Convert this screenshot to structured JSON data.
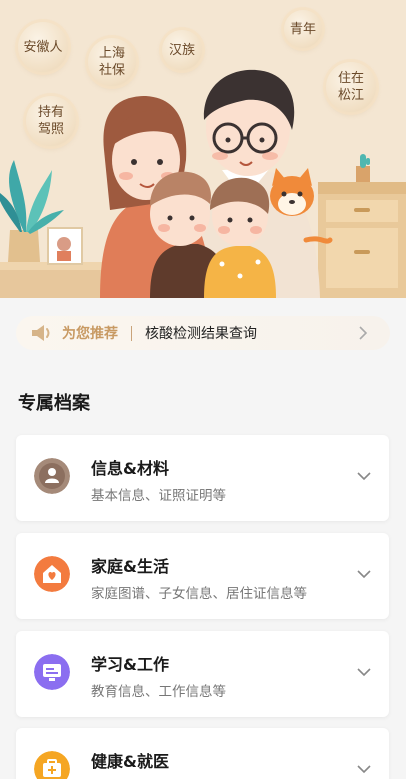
{
  "tags": [
    "安徽人",
    "上海社保",
    "汉族",
    "青年",
    "住在松江",
    "持有驾照"
  ],
  "recommend": {
    "label": "为您推荐",
    "text": "核酸检测结果查询"
  },
  "section_title": "专属档案",
  "cards": [
    {
      "title": "信息&材料",
      "subtitle": "基本信息、证照证明等",
      "icon": "person-info-icon",
      "color": "#a58a79"
    },
    {
      "title": "家庭&生活",
      "subtitle": "家庭图谱、子女信息、居住证信息等",
      "icon": "home-heart-icon",
      "color": "#f37b3f"
    },
    {
      "title": "学习&工作",
      "subtitle": "教育信息、工作信息等",
      "icon": "monitor-icon",
      "color": "#8b6ef0"
    },
    {
      "title": "健康&就医",
      "subtitle": "",
      "icon": "medkit-icon",
      "color": "#f5a623"
    }
  ]
}
